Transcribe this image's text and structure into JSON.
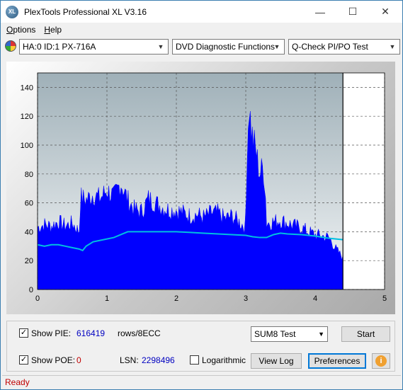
{
  "window": {
    "title": "PlexTools Professional XL V3.16",
    "icon_label": "XL",
    "minimize_glyph": "—",
    "maximize_glyph": "☐",
    "close_glyph": "✕"
  },
  "menu": [
    "Options",
    "Help"
  ],
  "toolbar": {
    "drive": "HA:0 ID:1  PX-716A",
    "function": "DVD Diagnostic Functions",
    "test": "Q-Check PI/PO Test"
  },
  "chart_data": {
    "type": "area",
    "xlim": [
      0,
      5
    ],
    "ylim": [
      0,
      150
    ],
    "x_ticks": [
      "0",
      "1",
      "2",
      "3",
      "4",
      "5"
    ],
    "y_ticks": [
      "0",
      "20",
      "40",
      "60",
      "80",
      "100",
      "120",
      "140"
    ],
    "grid": true,
    "data_end_x": 4.4,
    "series": [
      {
        "kind": "pie_bars",
        "color": "#0000ff",
        "x": [
          0.0,
          0.1,
          0.2,
          0.3,
          0.4,
          0.5,
          0.6,
          0.62,
          0.7,
          0.8,
          0.9,
          1.0,
          1.1,
          1.2,
          1.3,
          1.4,
          1.5,
          1.6,
          1.7,
          1.8,
          1.9,
          2.0,
          2.1,
          2.2,
          2.3,
          2.4,
          2.5,
          2.6,
          2.7,
          2.8,
          2.9,
          3.0,
          3.02,
          3.05,
          3.08,
          3.1,
          3.15,
          3.2,
          3.25,
          3.28,
          3.3,
          3.4,
          3.5,
          3.6,
          3.7,
          3.8,
          3.9,
          4.0,
          4.1,
          4.2,
          4.3,
          4.4
        ],
        "y": [
          43,
          45,
          44,
          47,
          44,
          46,
          40,
          64,
          62,
          66,
          63,
          69,
          64,
          74,
          62,
          55,
          54,
          63,
          60,
          57,
          55,
          55,
          53,
          51,
          52,
          50,
          53,
          53,
          49,
          51,
          47,
          43,
          100,
          128,
          110,
          105,
          95,
          80,
          85,
          70,
          46,
          47,
          48,
          46,
          44,
          43,
          40,
          38,
          37,
          36,
          28,
          22
        ]
      },
      {
        "kind": "pie_total_curve",
        "color": "#00c0e0",
        "x": [
          0.0,
          0.1,
          0.2,
          0.3,
          0.4,
          0.5,
          0.6,
          0.65,
          0.7,
          0.8,
          0.9,
          1.0,
          1.1,
          1.2,
          1.3,
          1.4,
          1.5,
          1.6,
          1.7,
          1.8,
          1.9,
          2.0,
          2.2,
          2.4,
          2.6,
          2.8,
          3.0,
          3.1,
          3.2,
          3.3,
          3.4,
          3.5,
          3.6,
          3.8,
          4.0,
          4.2,
          4.4
        ],
        "y": [
          31,
          30,
          31,
          31,
          30,
          29,
          28,
          27,
          30,
          33,
          34,
          35,
          36,
          38,
          40,
          40,
          40,
          40,
          40,
          40,
          40,
          40,
          39.5,
          39,
          38.5,
          38,
          37.5,
          36.5,
          36,
          36,
          38,
          39,
          38.5,
          38,
          37,
          35.5,
          34.5
        ]
      }
    ]
  },
  "controls": {
    "show_pie_label": "Show PIE:",
    "show_pie_checked": "✓",
    "pie_value": "616419",
    "rows_label": "rows/8ECC",
    "show_poe_label": "Show POE:",
    "show_poe_checked": "✓",
    "poe_value": "0",
    "lsn_label": "LSN:",
    "lsn_value": "2298496",
    "logarithmic_label": "Logarithmic",
    "sum_select": "SUM8 Test",
    "start_label": "Start",
    "view_log_label": "View Log",
    "preferences_label": "Preferences",
    "info_glyph": "i"
  },
  "status": "Ready"
}
